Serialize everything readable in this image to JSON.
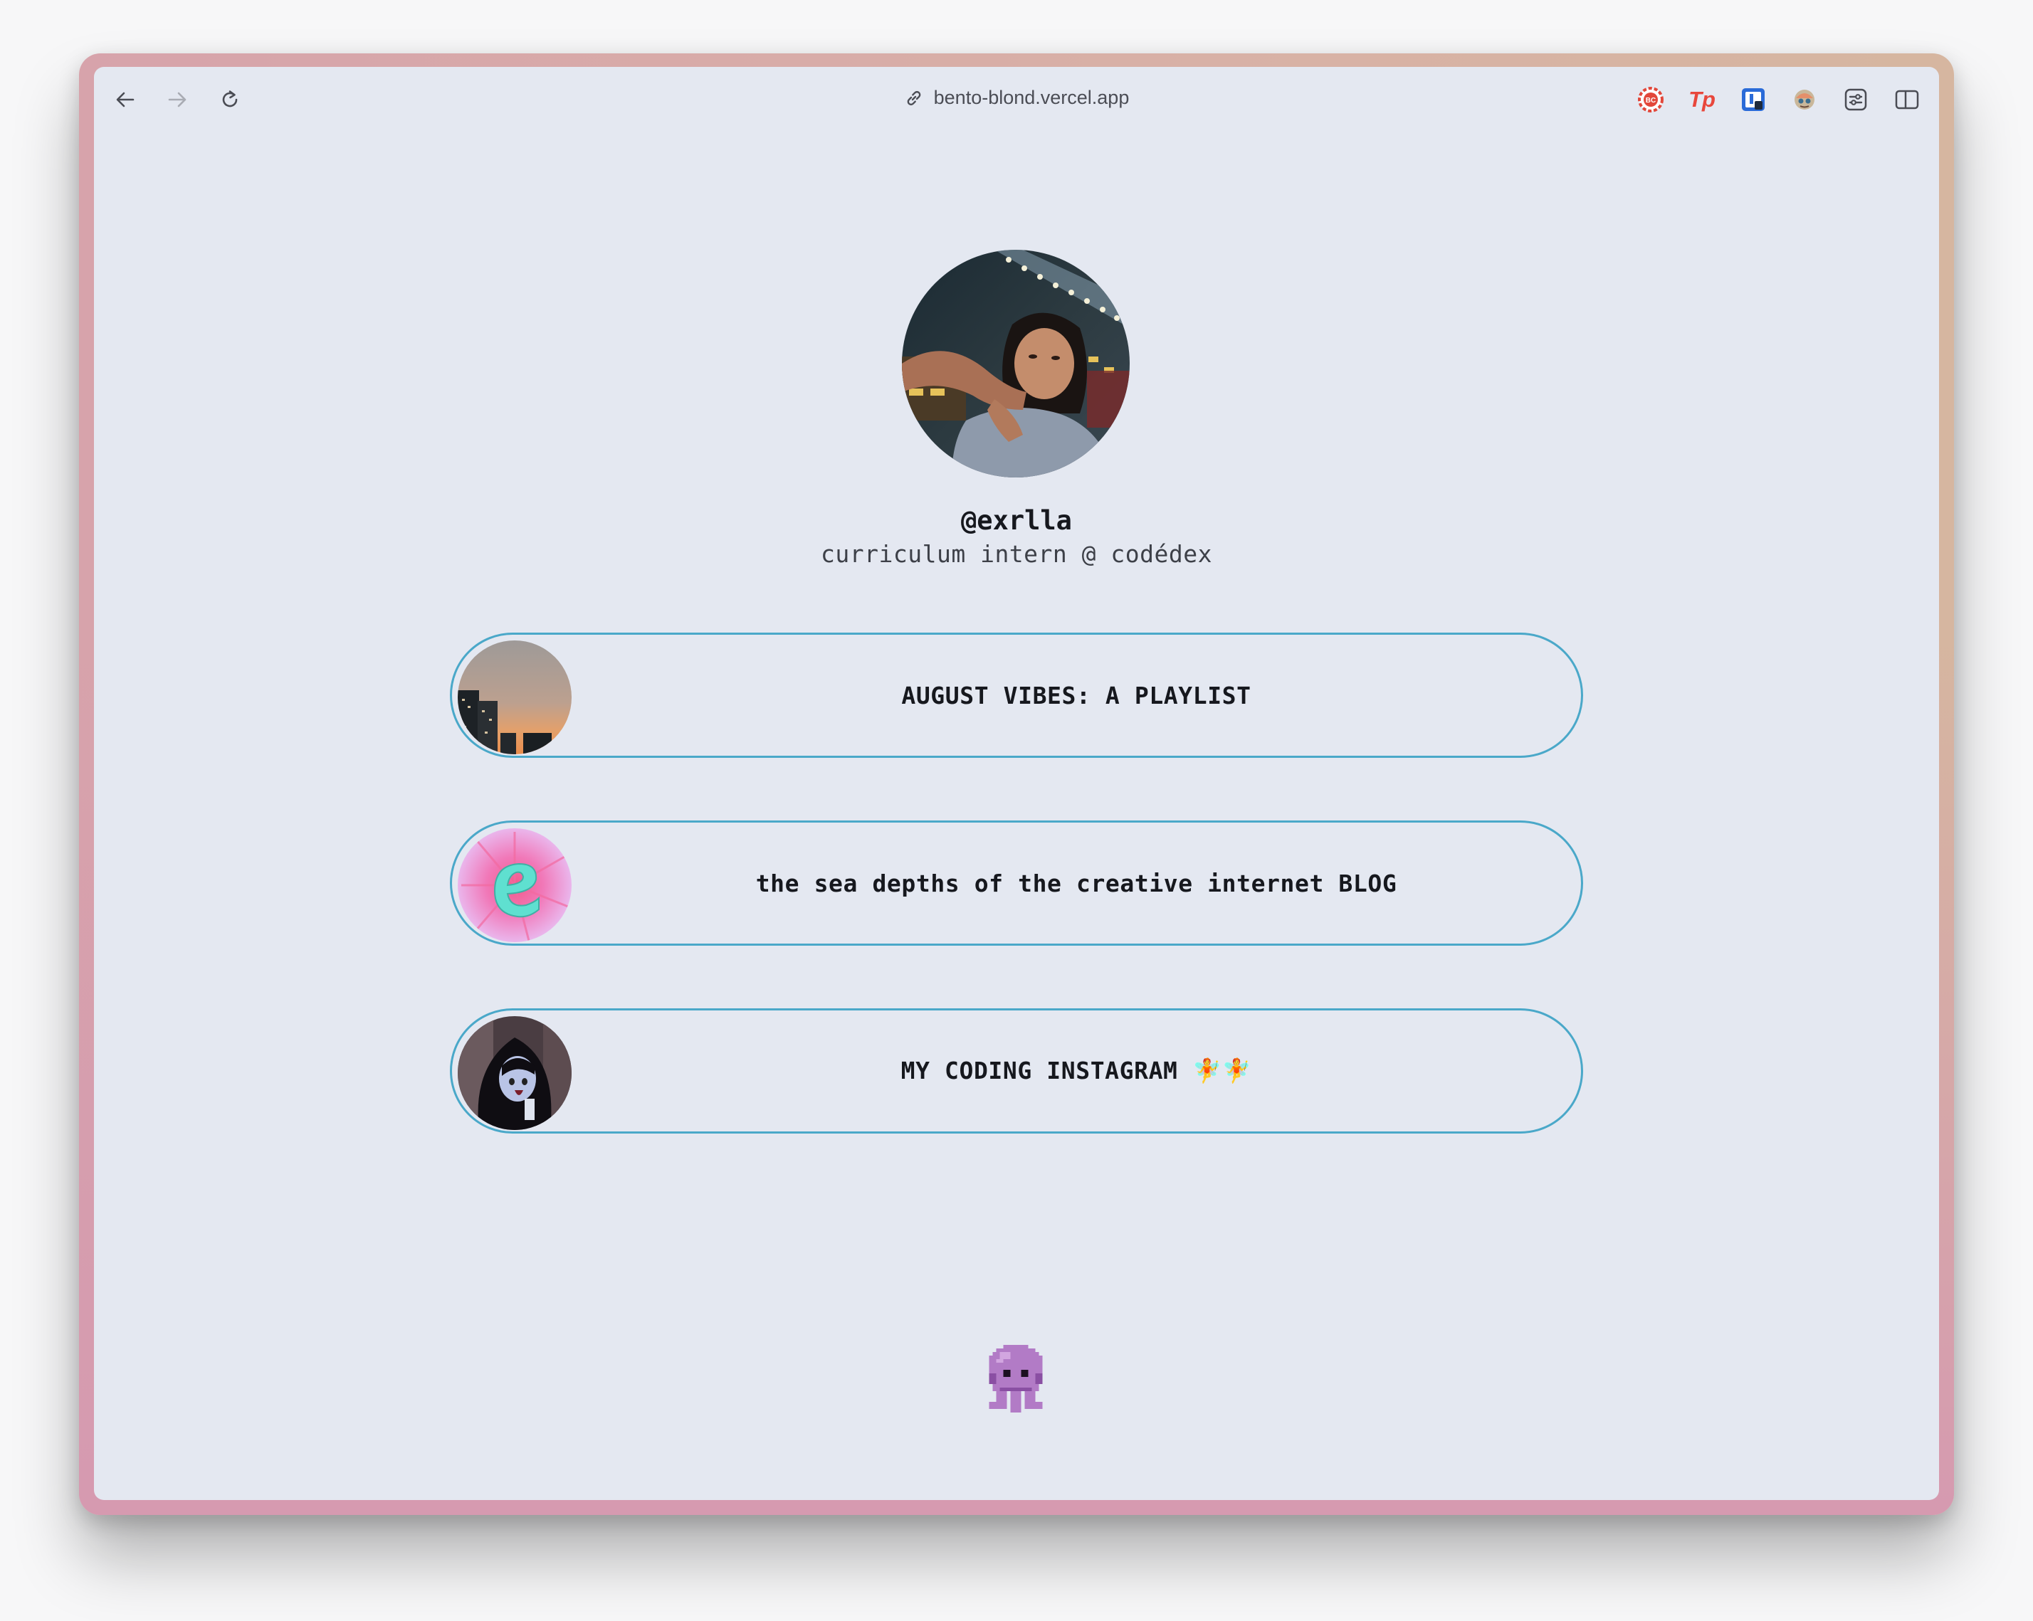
{
  "browser": {
    "url": "bento-blond.vercel.app",
    "back_icon": "arrow-left-icon",
    "forward_icon": "arrow-right-icon",
    "reload_icon": "reload-icon",
    "extensions": [
      "bc-extension-icon",
      "tp-extension-icon",
      "password-extension-icon",
      "avatar-extension-icon",
      "settings-extension-icon",
      "sidebar-toggle-icon"
    ],
    "extension_labels": {
      "bc": "BC",
      "tp": "Tp"
    }
  },
  "profile": {
    "username": "@exrlla",
    "bio": "curriculum intern @ codédex"
  },
  "links": [
    {
      "label": "AUGUST VIBES: A PLAYLIST",
      "thumb": "city-sunset-thumbnail"
    },
    {
      "label": "the sea depths of the creative internet BLOG",
      "thumb": "letter-e-thumbnail"
    },
    {
      "label": "MY CODING INSTAGRAM 🧚🧚",
      "thumb": "character-thumbnail"
    }
  ],
  "footer": {
    "mascot": "purple-octopus-mascot"
  },
  "colors": {
    "background": "#e4e8f1",
    "card_border": "#4aa8c9",
    "text": "#16181e"
  }
}
